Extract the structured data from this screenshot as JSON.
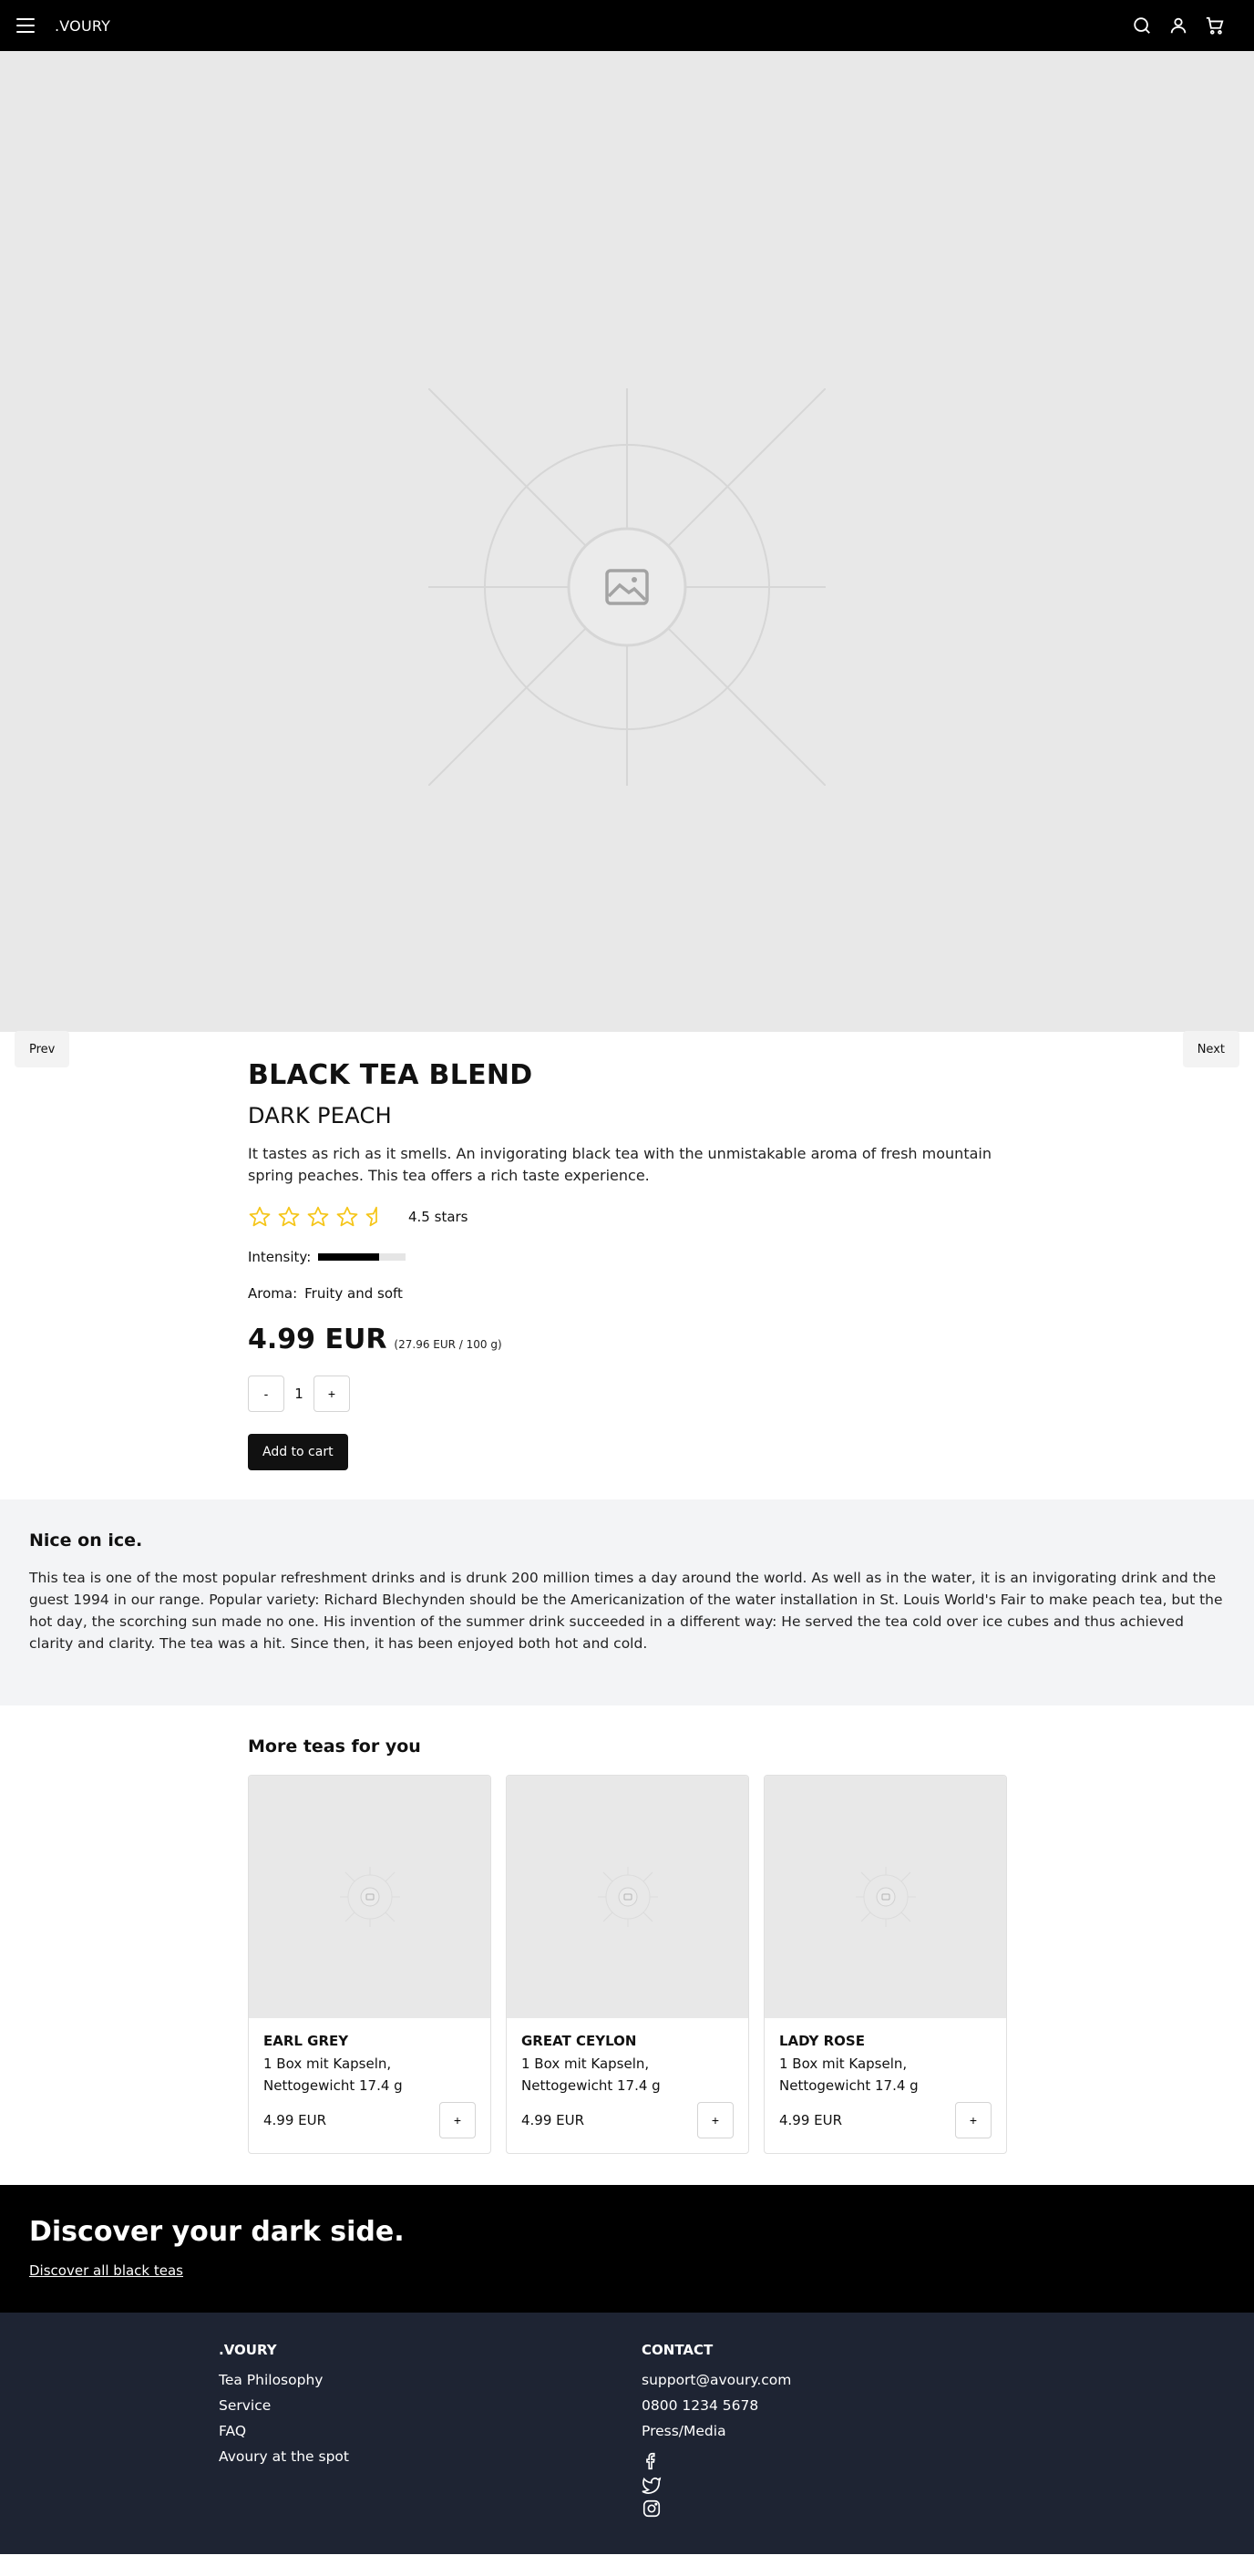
{
  "header": {
    "brand": ".VOURY",
    "icons": [
      "menu-icon",
      "search-icon",
      "user-icon",
      "cart-icon"
    ]
  },
  "hero": {
    "prev_label": "Prev",
    "next_label": "Next"
  },
  "product": {
    "title": "BLACK TEA BLEND",
    "subtitle": "DARK PEACH",
    "description": "It tastes as rich as it smells. An invigorating black tea with the unmistakable aroma of fresh mountain spring peaches. This tea offers a rich taste experience.",
    "rating": {
      "value": 4.5,
      "max": 5,
      "label": "4.5 stars"
    },
    "intensity": {
      "label": "Intensity:",
      "level": 0.7
    },
    "aroma": {
      "label": "Aroma:",
      "value": "Fruity and soft"
    },
    "price": "4.99 EUR",
    "unit_price": "(27.96 EUR / 100 g)",
    "quantity": {
      "minus": "-",
      "value": "1",
      "plus": "+"
    },
    "add_to_cart": "Add to cart"
  },
  "info": {
    "heading": "Nice on ice.",
    "text": "This tea is one of the most popular refreshment drinks and is drunk 200 million times a day around the world. As well as in the water, it is an invigorating drink and the guest 1994 in our range. Popular variety: Richard Blechynden should be the Americanization of the water installation in St. Louis World's Fair to make peach tea, but the hot day, the scorching sun made no one. His invention of the summer drink succeeded in a different way: He served the tea cold over ice cubes and thus achieved clarity and clarity. The tea was a hit. Since then, it has been enjoyed both hot and cold."
  },
  "more": {
    "heading": "More teas for you",
    "items": [
      {
        "name": "EARL GREY",
        "desc": "1 Box mit Kapseln, Nettogewicht 17.4 g",
        "price": "4.99 EUR",
        "add": "+"
      },
      {
        "name": "GREAT CEYLON",
        "desc": "1 Box mit Kapseln, Nettogewicht 17.4 g",
        "price": "4.99 EUR",
        "add": "+"
      },
      {
        "name": "LADY ROSE",
        "desc": "1 Box mit Kapseln, Nettogewicht 17.4 g",
        "price": "4.99 EUR",
        "add": "+"
      }
    ]
  },
  "banner": {
    "heading": "Discover your dark side.",
    "link": "Discover all black teas"
  },
  "footer": {
    "col1": {
      "heading": ".VOURY",
      "links": [
        "Tea Philosophy",
        "Service",
        "FAQ",
        "Avoury at the spot"
      ]
    },
    "col2": {
      "heading": "CONTACT",
      "links": [
        "support@avoury.com",
        "0800 1234 5678",
        "Press/Media"
      ]
    },
    "social": [
      "facebook-icon",
      "twitter-icon",
      "instagram-icon"
    ]
  },
  "colors": {
    "star": "#f5c518",
    "hero_bg": "#e8e8e8",
    "info_bg": "#f3f4f6",
    "footer_bg": "#1e2433"
  }
}
